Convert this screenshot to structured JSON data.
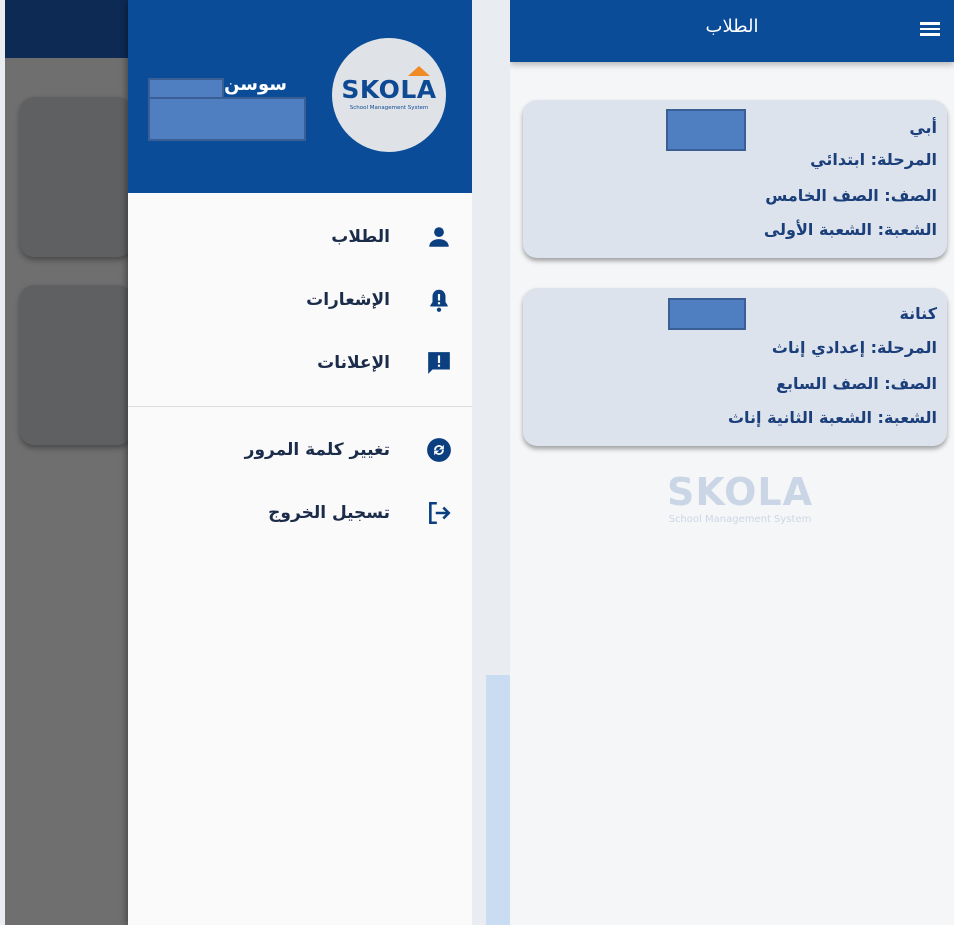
{
  "drawer": {
    "logo": {
      "brand": "SKOLA",
      "tagline": "School Management System"
    },
    "user_first_name": "سوسن",
    "menu": [
      {
        "label": "الطلاب",
        "icon": "person-icon"
      },
      {
        "label": "الإشعارات",
        "icon": "bell-alert-icon"
      },
      {
        "label": "الإعلانات",
        "icon": "announcement-icon"
      },
      {
        "label": "تغيير كلمة المرور",
        "icon": "refresh-circle-icon"
      },
      {
        "label": "تسجيل الخروج",
        "icon": "logout-icon"
      }
    ]
  },
  "students_screen": {
    "title": "الطلاب",
    "cards": [
      {
        "name": "أبي",
        "stage": "المرحلة: ابتدائي",
        "grade": "الصف: الصف الخامس",
        "section": "الشعبة: الشعبة الأولى"
      },
      {
        "name": "كنانة",
        "stage": "المرحلة: إعدادي إناث",
        "grade": "الصف: الصف السابع",
        "section": "الشعبة: الشعبة الثانية إناث"
      }
    ],
    "watermark": {
      "brand": "SKOLA",
      "tagline": "School Management System"
    }
  },
  "colors": {
    "primary": "#0b4c99",
    "accent": "#f08a24",
    "text": "#1b3f7a"
  }
}
